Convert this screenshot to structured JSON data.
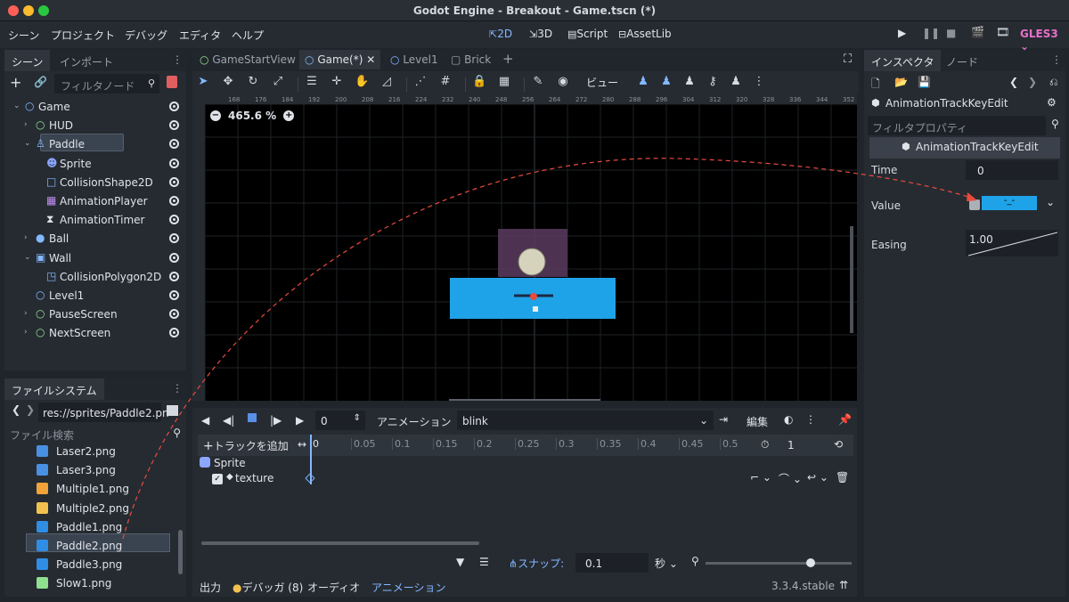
{
  "window": {
    "title": "Godot Engine - Breakout - Game.tscn (*)"
  },
  "menubar": {
    "items": [
      "シーン",
      "プロジェクト",
      "デバッグ",
      "エディタ",
      "ヘルプ"
    ],
    "workspaces": [
      "2D",
      "3D",
      "Script",
      "AssetLib"
    ],
    "renderer": "GLES3"
  },
  "scene_dock": {
    "tabs": [
      "シーン",
      "インポート"
    ],
    "filter_placeholder": "フィルタノード",
    "nodes": [
      {
        "name": "Game",
        "depth": 0,
        "icon": "node2d-circle-icon",
        "arrow": "v"
      },
      {
        "name": "HUD",
        "depth": 1,
        "icon": "canvaslayer-circle-icon",
        "arrow": ">"
      },
      {
        "name": "Paddle",
        "depth": 1,
        "icon": "kinematic-body-icon",
        "arrow": "v"
      },
      {
        "name": "Sprite",
        "depth": 2,
        "icon": "sprite-icon",
        "arrow": ""
      },
      {
        "name": "CollisionShape2D",
        "depth": 2,
        "icon": "collision-shape-icon",
        "arrow": ""
      },
      {
        "name": "AnimationPlayer",
        "depth": 2,
        "icon": "animation-player-icon",
        "arrow": ""
      },
      {
        "name": "AnimationTimer",
        "depth": 2,
        "icon": "timer-icon",
        "arrow": ""
      },
      {
        "name": "Ball",
        "depth": 1,
        "icon": "rigid-body-icon",
        "arrow": ">"
      },
      {
        "name": "Wall",
        "depth": 1,
        "icon": "static-body-icon",
        "arrow": "v"
      },
      {
        "name": "CollisionPolygon2D",
        "depth": 2,
        "icon": "collision-polygon-icon",
        "arrow": ""
      },
      {
        "name": "Level1",
        "depth": 1,
        "icon": "node2d-circle-icon",
        "arrow": ""
      },
      {
        "name": "PauseScreen",
        "depth": 1,
        "icon": "node-circle-icon",
        "arrow": ">"
      },
      {
        "name": "NextScreen",
        "depth": 1,
        "icon": "node-circle-icon",
        "arrow": ">"
      }
    ]
  },
  "filesystem": {
    "tab": "ファイルシステム",
    "path": "res://sprites/Paddle2.pn",
    "search_placeholder": "ファイル検索",
    "files": [
      "Laser2.png",
      "Laser3.png",
      "Multiple1.png",
      "Multiple2.png",
      "Paddle1.png",
      "Paddle2.png",
      "Paddle3.png",
      "Slow1.png"
    ]
  },
  "editor_tabs": [
    "GameStartView",
    "Game(*)",
    "Level1",
    "Brick"
  ],
  "viewport": {
    "zoom": "465.6 %",
    "ruler_labels": [
      "168",
      "176",
      "184",
      "192",
      "200",
      "208",
      "216",
      "224",
      "232",
      "240",
      "248",
      "256",
      "264",
      "272",
      "280",
      "288",
      "296",
      "304",
      "312",
      "320",
      "328",
      "336",
      "344",
      "352"
    ],
    "view_menu": "ビュー"
  },
  "animation": {
    "frame_value": "0",
    "anim_label": "アニメーション",
    "anim_name": "blink",
    "edit_label": "編集",
    "add_track": "トラックを追加",
    "times": [
      "0",
      "0.05",
      "0.1",
      "0.15",
      "0.2",
      "0.25",
      "0.3",
      "0.35",
      "0.4",
      "0.45",
      "0.5"
    ],
    "length": "1",
    "track_node": "Sprite",
    "track_prop": "texture",
    "snap_label": "スナップ:",
    "snap_value": "0.1",
    "snap_unit": "秒"
  },
  "bottom_bar": {
    "items": [
      "出力",
      "デバッガ (8)",
      "オーディオ",
      "アニメーション"
    ],
    "version": "3.3.4.stable"
  },
  "inspector": {
    "tabs": [
      "インスペクタ",
      "ノード"
    ],
    "object": "AnimationTrackKeyEdit",
    "filter_placeholder": "フィルタプロパティ",
    "section": "AnimationTrackKeyEdit",
    "props": {
      "time_label": "Time",
      "time_value": "0",
      "value_label": "Value",
      "value_text": "-_-",
      "easing_label": "Easing",
      "easing_value": "1.00"
    }
  },
  "colors": {
    "accent": "#84b8ff",
    "paddle": "#1fa3e8",
    "selection": "#e84b3c"
  }
}
